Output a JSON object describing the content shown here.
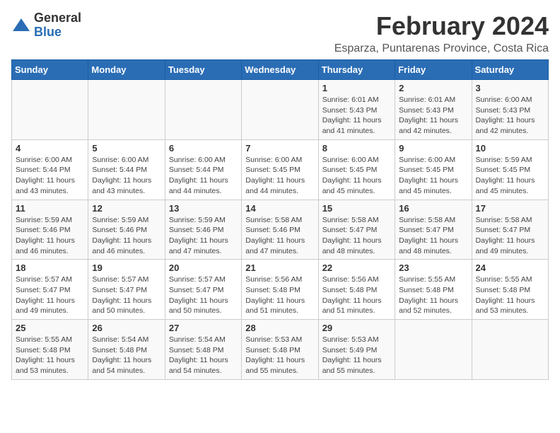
{
  "logo": {
    "general": "General",
    "blue": "Blue"
  },
  "title": "February 2024",
  "subtitle": "Esparza, Puntarenas Province, Costa Rica",
  "headers": [
    "Sunday",
    "Monday",
    "Tuesday",
    "Wednesday",
    "Thursday",
    "Friday",
    "Saturday"
  ],
  "weeks": [
    [
      {
        "day": "",
        "info": ""
      },
      {
        "day": "",
        "info": ""
      },
      {
        "day": "",
        "info": ""
      },
      {
        "day": "",
        "info": ""
      },
      {
        "day": "1",
        "info": "Sunrise: 6:01 AM\nSunset: 5:43 PM\nDaylight: 11 hours and 41 minutes."
      },
      {
        "day": "2",
        "info": "Sunrise: 6:01 AM\nSunset: 5:43 PM\nDaylight: 11 hours and 42 minutes."
      },
      {
        "day": "3",
        "info": "Sunrise: 6:00 AM\nSunset: 5:43 PM\nDaylight: 11 hours and 42 minutes."
      }
    ],
    [
      {
        "day": "4",
        "info": "Sunrise: 6:00 AM\nSunset: 5:44 PM\nDaylight: 11 hours and 43 minutes."
      },
      {
        "day": "5",
        "info": "Sunrise: 6:00 AM\nSunset: 5:44 PM\nDaylight: 11 hours and 43 minutes."
      },
      {
        "day": "6",
        "info": "Sunrise: 6:00 AM\nSunset: 5:44 PM\nDaylight: 11 hours and 44 minutes."
      },
      {
        "day": "7",
        "info": "Sunrise: 6:00 AM\nSunset: 5:45 PM\nDaylight: 11 hours and 44 minutes."
      },
      {
        "day": "8",
        "info": "Sunrise: 6:00 AM\nSunset: 5:45 PM\nDaylight: 11 hours and 45 minutes."
      },
      {
        "day": "9",
        "info": "Sunrise: 6:00 AM\nSunset: 5:45 PM\nDaylight: 11 hours and 45 minutes."
      },
      {
        "day": "10",
        "info": "Sunrise: 5:59 AM\nSunset: 5:45 PM\nDaylight: 11 hours and 45 minutes."
      }
    ],
    [
      {
        "day": "11",
        "info": "Sunrise: 5:59 AM\nSunset: 5:46 PM\nDaylight: 11 hours and 46 minutes."
      },
      {
        "day": "12",
        "info": "Sunrise: 5:59 AM\nSunset: 5:46 PM\nDaylight: 11 hours and 46 minutes."
      },
      {
        "day": "13",
        "info": "Sunrise: 5:59 AM\nSunset: 5:46 PM\nDaylight: 11 hours and 47 minutes."
      },
      {
        "day": "14",
        "info": "Sunrise: 5:58 AM\nSunset: 5:46 PM\nDaylight: 11 hours and 47 minutes."
      },
      {
        "day": "15",
        "info": "Sunrise: 5:58 AM\nSunset: 5:47 PM\nDaylight: 11 hours and 48 minutes."
      },
      {
        "day": "16",
        "info": "Sunrise: 5:58 AM\nSunset: 5:47 PM\nDaylight: 11 hours and 48 minutes."
      },
      {
        "day": "17",
        "info": "Sunrise: 5:58 AM\nSunset: 5:47 PM\nDaylight: 11 hours and 49 minutes."
      }
    ],
    [
      {
        "day": "18",
        "info": "Sunrise: 5:57 AM\nSunset: 5:47 PM\nDaylight: 11 hours and 49 minutes."
      },
      {
        "day": "19",
        "info": "Sunrise: 5:57 AM\nSunset: 5:47 PM\nDaylight: 11 hours and 50 minutes."
      },
      {
        "day": "20",
        "info": "Sunrise: 5:57 AM\nSunset: 5:47 PM\nDaylight: 11 hours and 50 minutes."
      },
      {
        "day": "21",
        "info": "Sunrise: 5:56 AM\nSunset: 5:48 PM\nDaylight: 11 hours and 51 minutes."
      },
      {
        "day": "22",
        "info": "Sunrise: 5:56 AM\nSunset: 5:48 PM\nDaylight: 11 hours and 51 minutes."
      },
      {
        "day": "23",
        "info": "Sunrise: 5:55 AM\nSunset: 5:48 PM\nDaylight: 11 hours and 52 minutes."
      },
      {
        "day": "24",
        "info": "Sunrise: 5:55 AM\nSunset: 5:48 PM\nDaylight: 11 hours and 53 minutes."
      }
    ],
    [
      {
        "day": "25",
        "info": "Sunrise: 5:55 AM\nSunset: 5:48 PM\nDaylight: 11 hours and 53 minutes."
      },
      {
        "day": "26",
        "info": "Sunrise: 5:54 AM\nSunset: 5:48 PM\nDaylight: 11 hours and 54 minutes."
      },
      {
        "day": "27",
        "info": "Sunrise: 5:54 AM\nSunset: 5:48 PM\nDaylight: 11 hours and 54 minutes."
      },
      {
        "day": "28",
        "info": "Sunrise: 5:53 AM\nSunset: 5:48 PM\nDaylight: 11 hours and 55 minutes."
      },
      {
        "day": "29",
        "info": "Sunrise: 5:53 AM\nSunset: 5:49 PM\nDaylight: 11 hours and 55 minutes."
      },
      {
        "day": "",
        "info": ""
      },
      {
        "day": "",
        "info": ""
      }
    ]
  ]
}
